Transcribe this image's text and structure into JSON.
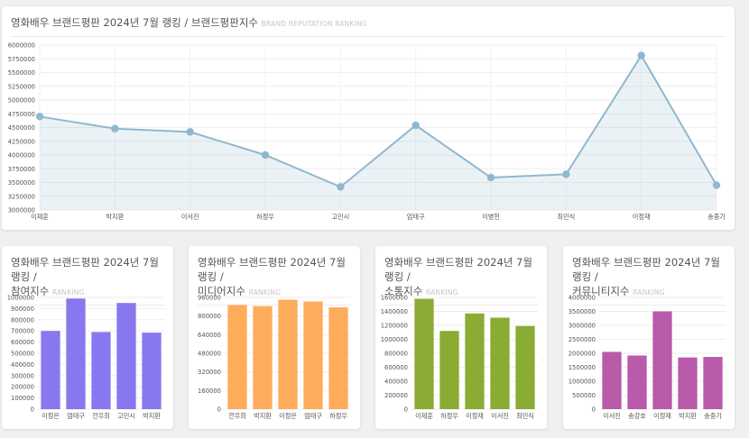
{
  "main_card": {
    "title": "영화배우 브랜드평판 2024년 7월 랭킹 / 브랜드평판지수",
    "subtitle": "BRAND REPUTATION RANKING"
  },
  "small_cards": [
    {
      "title_line1": "영화배우 브랜드평판 2024년 7월 랭킹 /",
      "title_line2": "참여지수",
      "subtitle": "RANKING"
    },
    {
      "title_line1": "영화배우 브랜드평판 2024년 7월 랭킹 /",
      "title_line2": "미디어지수",
      "subtitle": "RANKING"
    },
    {
      "title_line1": "영화배우 브랜드평판 2024년 7월 랭킹 /",
      "title_line2": "소통지수",
      "subtitle": "RANKING"
    },
    {
      "title_line1": "영화배우 브랜드평판 2024년 7월 랭킹 /",
      "title_line2": "커뮤니티지수",
      "subtitle": "RANKING"
    }
  ],
  "chart_data": [
    {
      "type": "area",
      "categories": [
        "이제훈",
        "박지환",
        "이서진",
        "하정우",
        "고민시",
        "엄태구",
        "이병헌",
        "최민식",
        "이정재",
        "송중기"
      ],
      "values": [
        4700000,
        4480000,
        4420000,
        4000000,
        3420000,
        4540000,
        3590000,
        3650000,
        5810000,
        3450000
      ],
      "ylim": [
        3000000,
        6000000
      ],
      "yticks": [
        3000000,
        3250000,
        3500000,
        3750000,
        4000000,
        4250000,
        4500000,
        4750000,
        5000000,
        5250000,
        5500000,
        5750000,
        6000000
      ],
      "grid": true,
      "color": "#8fb8cf"
    },
    {
      "type": "bar",
      "categories": [
        "이정은",
        "엄태구",
        "전우희",
        "고민시",
        "박지환"
      ],
      "values": [
        700000,
        990000,
        690000,
        950000,
        685000
      ],
      "ylim": [
        0,
        1000000
      ],
      "yticks": [
        0,
        100000,
        200000,
        300000,
        400000,
        500000,
        600000,
        700000,
        800000,
        900000,
        1000000
      ],
      "color": "#8878f0"
    },
    {
      "type": "bar",
      "categories": [
        "전우희",
        "박지환",
        "이정은",
        "엄태구",
        "하정우"
      ],
      "values": [
        895000,
        885000,
        940000,
        925000,
        875000
      ],
      "ylim": [
        0,
        960000
      ],
      "yticks": [
        0,
        160000,
        320000,
        480000,
        640000,
        800000,
        960000
      ],
      "color": "#fdac5c"
    },
    {
      "type": "bar",
      "categories": [
        "이제훈",
        "하정우",
        "이정재",
        "이서진",
        "최민식"
      ],
      "values": [
        1580000,
        1120000,
        1370000,
        1310000,
        1190000
      ],
      "ylim": [
        0,
        1600000
      ],
      "yticks": [
        0,
        200000,
        400000,
        600000,
        800000,
        1000000,
        1200000,
        1400000,
        1600000
      ],
      "color": "#8aab34"
    },
    {
      "type": "bar",
      "categories": [
        "이서진",
        "송강호",
        "이정재",
        "박지환",
        "송중기"
      ],
      "values": [
        2050000,
        1920000,
        3500000,
        1850000,
        1870000
      ],
      "ylim": [
        0,
        4000000
      ],
      "yticks": [
        0,
        500000,
        1000000,
        1500000,
        2000000,
        2500000,
        3000000,
        3500000,
        4000000
      ],
      "color": "#b95aaa"
    }
  ]
}
